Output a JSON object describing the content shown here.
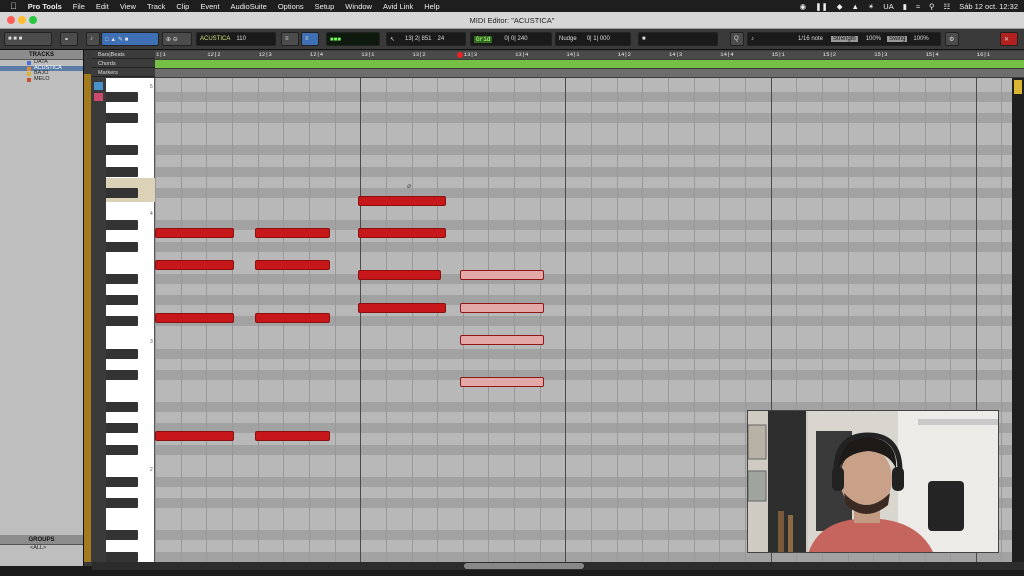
{
  "menubar": {
    "app": "Pro Tools",
    "items": [
      "File",
      "Edit",
      "View",
      "Track",
      "Clip",
      "Event",
      "AudioSuite",
      "Options",
      "Setup",
      "Window",
      "Avid Link",
      "Help"
    ],
    "input_source": "UA",
    "datetime": "Sáb 12 oct.  12:32"
  },
  "window": {
    "title": "MIDI Editor: \"ACUSTICA\""
  },
  "toolbar": {
    "track_selector": "ACUSTICA",
    "midi_value": "110",
    "counter": "13| 2| 851",
    "counter2": "24",
    "grid_label": "Grid",
    "grid_value": "0| 0| 240",
    "nudge_label": "Nudge",
    "nudge_value": "0| 1| 000",
    "quantize_note": "1/16 note",
    "strength_label": "Strength",
    "strength_value": "100%",
    "swing_label": "Swing",
    "swing_value": "100%"
  },
  "tracks_panel": {
    "header": "TRACKS",
    "tracks": [
      {
        "name": "DATA",
        "color": "#4a6fd1"
      },
      {
        "name": "ACUSTICA",
        "color": "#e28c2a"
      },
      {
        "name": "BAJO",
        "color": "#d9b533"
      },
      {
        "name": "MELO",
        "color": "#c94f2b"
      }
    ]
  },
  "groups_panel": {
    "header": "GROUPS",
    "item": "<ALL>"
  },
  "rulers": {
    "bars_label": "Bars|Beats",
    "chords_label": "Chords",
    "markers_label": "Markers",
    "bars": [
      "1|1",
      "12|2",
      "12|3",
      "12|4",
      "13|1",
      "13|2",
      "13|3",
      "13|4",
      "14|1",
      "14|2",
      "14|3",
      "14|4",
      "15|1",
      "15|2",
      "15|3",
      "15|4",
      "16|1"
    ]
  },
  "piano": {
    "octave_labels": [
      "5",
      "4",
      "3",
      "2"
    ]
  },
  "notes": [
    {
      "start_bar": 12.0,
      "len_beats": 0.9,
      "lane": 18,
      "selected": false
    },
    {
      "start_bar": 12.2,
      "len_beats": 0.85,
      "lane": 18,
      "selected": false
    },
    {
      "start_bar": 12.4,
      "len_beats": 1.0,
      "lane": 15,
      "selected": false
    },
    {
      "start_bar": 12.4,
      "len_beats": 1.0,
      "lane": 18,
      "selected": false
    },
    {
      "start_bar": 12.0,
      "len_beats": 0.9,
      "lane": 21,
      "selected": false
    },
    {
      "start_bar": 12.2,
      "len_beats": 0.85,
      "lane": 21,
      "selected": false
    },
    {
      "start_bar": 12.4,
      "len_beats": 0.95,
      "lane": 22,
      "selected": false
    },
    {
      "start_bar": 12.6,
      "len_beats": 0.95,
      "lane": 22,
      "selected": true
    },
    {
      "start_bar": 12.4,
      "len_beats": 1.0,
      "lane": 25,
      "selected": false
    },
    {
      "start_bar": 12.6,
      "len_beats": 0.95,
      "lane": 25,
      "selected": true
    },
    {
      "start_bar": 12.0,
      "len_beats": 0.9,
      "lane": 26,
      "selected": false
    },
    {
      "start_bar": 12.2,
      "len_beats": 0.85,
      "lane": 26,
      "selected": false
    },
    {
      "start_bar": 12.6,
      "len_beats": 0.95,
      "lane": 28,
      "selected": true
    },
    {
      "start_bar": 12.6,
      "len_beats": 0.95,
      "lane": 32,
      "selected": true
    },
    {
      "start_bar": 12.0,
      "len_beats": 0.9,
      "lane": 37,
      "selected": false
    },
    {
      "start_bar": 12.2,
      "len_beats": 0.85,
      "lane": 37,
      "selected": false
    }
  ],
  "colors": {
    "note": "#c8171a",
    "note_selected": "#e3a9a9",
    "accent_green": "#76c043"
  }
}
